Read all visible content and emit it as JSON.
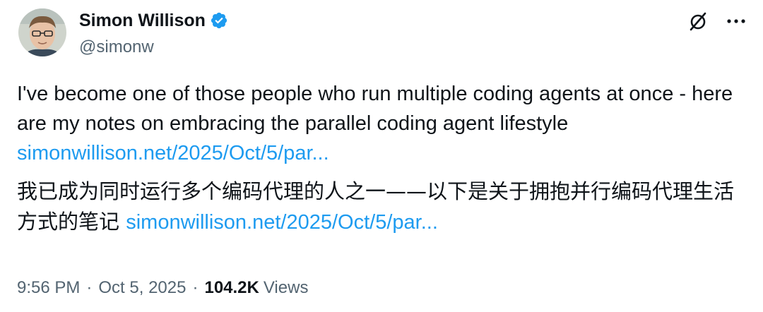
{
  "author": {
    "display_name": "Simon Willison",
    "handle": "@simonw",
    "verified": true
  },
  "tweet": {
    "paragraphs": [
      {
        "text": "I've become one of those people who run multiple coding agents at once - here are my notes on embracing the parallel coding agent lifestyle ",
        "link": "simonwillison.net/2025/Oct/5/par..."
      },
      {
        "text": "我已成为同时运行多个编码代理的人之一——以下是关于拥抱并行编码代理生活方式的笔记 ",
        "link": "simonwillison.net/2025/Oct/5/par..."
      }
    ]
  },
  "meta": {
    "time": "9:56 PM",
    "separator": "·",
    "date": "Oct 5, 2025",
    "views_count": "104.2K",
    "views_label": "Views"
  },
  "icons": {
    "verified": "verified-badge-icon",
    "grok": "grok-icon",
    "more": "more-options-icon"
  },
  "colors": {
    "link": "#1d9bf0",
    "secondary_text": "#536471",
    "primary_text": "#0f1419",
    "verified": "#1d9bf0"
  }
}
